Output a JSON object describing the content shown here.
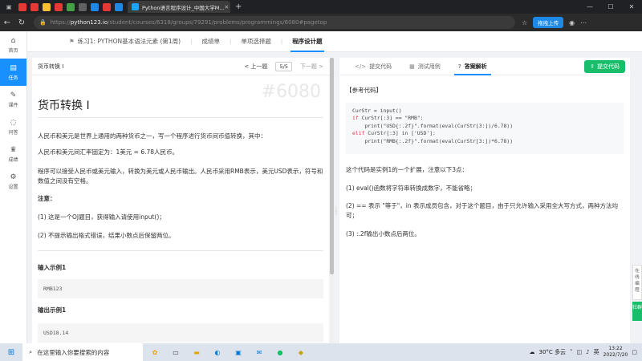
{
  "browser": {
    "tab_title": "Python语言程序设计_中国大学M...",
    "url_prefix": "https://",
    "url_host": "python123.io",
    "url_path": "/student/courses/6318/groups/79291/problems/programmings/6080#pagetop",
    "upload_label": "拖拽上传"
  },
  "sidebar": {
    "items": [
      {
        "label": "首页",
        "icon": "home-icon"
      },
      {
        "label": "任务",
        "icon": "task-icon"
      },
      {
        "label": "课件",
        "icon": "courseware-icon"
      },
      {
        "label": "问答",
        "icon": "qa-icon"
      },
      {
        "label": "成绩",
        "icon": "trophy-icon"
      },
      {
        "label": "设置",
        "icon": "gear-icon"
      }
    ]
  },
  "subnav": {
    "back_title": "练习1: PYTHON基本语法元素 (第1周)",
    "items": [
      "成绩单",
      "单项选择题",
      "程序设计题"
    ]
  },
  "problem": {
    "header_name": "货币转换 I",
    "prev_label": "< 上一题",
    "page": "5/5",
    "next_label": "下一题 >",
    "watermark": "#6080",
    "title": "货币转换 I",
    "p1": "人民币和美元是世界上通用的两种货币之一，写一个程序进行货币间币值转换，其中：",
    "p2": "人民币和美元间汇率固定为：1美元 = 6.78人民币。",
    "p3": "程序可以接受人民币或美元输入，转换为美元或人民币输出。人民币采用RMB表示，美元USD表示，符号和数值之间没有空格。",
    "note_title": "注意：",
    "note1": "(1) 这是一个OJ题目，获得输入请使用input()；",
    "note2": "(2) 不提示输出格式错误，结果小数点后保留两位。",
    "input_title": "输入示例1",
    "input_value": "RMB123",
    "output_title": "输出示例1",
    "output_value": "USD18.14"
  },
  "answer": {
    "tabs": [
      "提交代码",
      "测试用例",
      "答案解析"
    ],
    "submit_label": "提交代码",
    "ref_label": "【参考代码】",
    "code": [
      "CurStr = input()",
      "if CurStr[:3] == \"RMB\":",
      "    print(\"USD{:.2f}\".format(eval(CurStr[3:])/6.78))",
      "elif CurStr[:3] in ['USD']:",
      "    print(\"RMB{:.2f}\".format(eval(CurStr[3:])*6.78))"
    ],
    "e1": "这个代码是实例1的一个扩展，注意以下3点：",
    "e2": "(1) eval()函数将字符串转换成数字，不能省略；",
    "e3": "(2) == 表示 \"等于\"，in 表示成员包含，对于这个题目，由于只允许输入采用全大写方式，两种方法均可；",
    "e4": "(3) :.2f输出小数点后两位。"
  },
  "float_widget": {
    "label": "在线编程",
    "green_label": "社群"
  },
  "taskbar": {
    "search_placeholder": "在这里输入你要搜索的内容",
    "weather": "30°C 多云",
    "lang": "英",
    "time": "13:22",
    "date": "2022/7/20"
  }
}
